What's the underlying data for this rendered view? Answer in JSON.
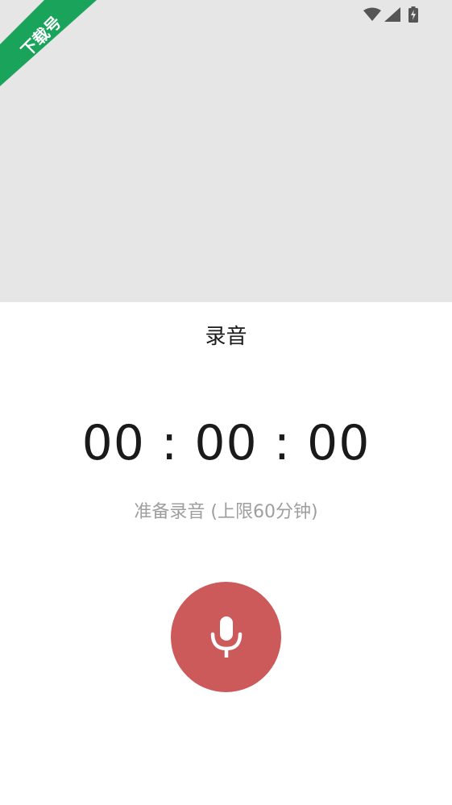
{
  "watermark": {
    "text": "下载号",
    "color": "#1aa35a"
  },
  "status_bar": {
    "icons": [
      "wifi-icon",
      "cellular-signal-icon",
      "battery-charging-icon"
    ]
  },
  "recorder": {
    "title": "录音",
    "timer": "00 : 00 : 00",
    "status": "准备录音 (上限60分钟)",
    "record_button_icon": "microphone-icon",
    "accent_color": "#cd5a5a"
  }
}
